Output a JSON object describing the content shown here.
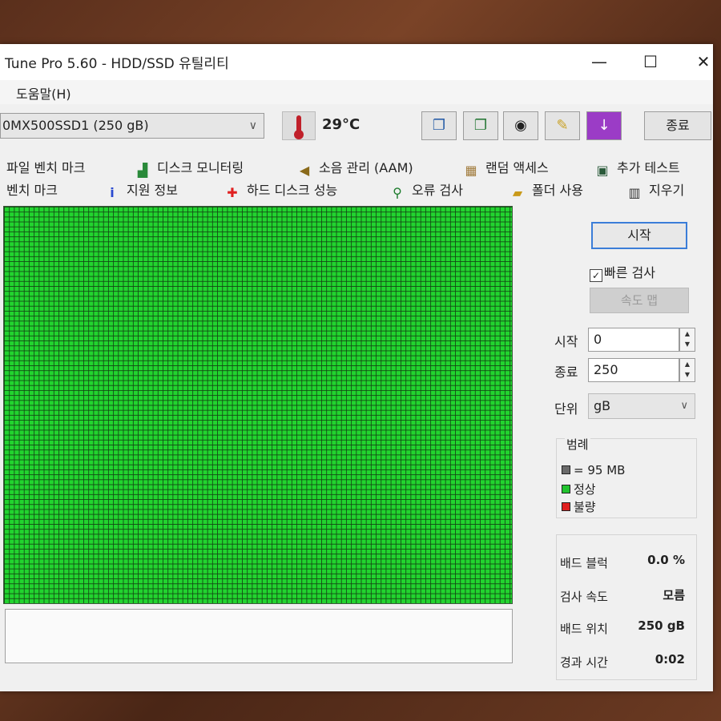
{
  "window": {
    "title": "Tune Pro 5.60 - HDD/SSD  유틸리티",
    "min_glyph": "—",
    "max_glyph": "☐",
    "close_glyph": "✕"
  },
  "menu": {
    "items": [
      {
        "label": "도움말(H)"
      }
    ]
  },
  "toolbar": {
    "drive": "0MX500SSD1 (250 gB)",
    "temperature": "29°C",
    "exit_label": "종료",
    "buttons": [
      {
        "icon": "copy-info-icon",
        "glyph": "❐"
      },
      {
        "icon": "copy-screenshot-icon",
        "glyph": "❐"
      },
      {
        "icon": "camera-icon",
        "glyph": "◉"
      },
      {
        "icon": "options-icon",
        "glyph": "✎"
      },
      {
        "icon": "download-icon",
        "glyph": "↓"
      }
    ]
  },
  "tabs": {
    "row1": [
      {
        "label": "파일 벤치 마크",
        "icon": "file-benchmark-icon"
      },
      {
        "label": "디스크 모니터링",
        "icon": "disk-monitor-icon"
      },
      {
        "label": "소음 관리 (AAM)",
        "icon": "speaker-icon"
      },
      {
        "label": "랜덤 액세스",
        "icon": "random-access-icon"
      },
      {
        "label": "추가 테스트",
        "icon": "extra-tests-icon"
      }
    ],
    "row2": [
      {
        "label": "벤치 마크",
        "icon": "benchmark-icon"
      },
      {
        "label": "지원 정보",
        "icon": "info-icon"
      },
      {
        "label": "하드 디스크 성능",
        "icon": "health-cross-icon"
      },
      {
        "label": "오류 검사",
        "icon": "error-scan-icon"
      },
      {
        "label": "폴더 사용",
        "icon": "folder-icon"
      },
      {
        "label": "지우기",
        "icon": "trash-icon"
      }
    ]
  },
  "controls": {
    "start_label": "시작",
    "quick_scan_label": "빠른 검사",
    "quick_scan_checked": true,
    "speed_map_label": "속도 맵",
    "start_field_label": "시작",
    "start_value": "0",
    "end_field_label": "종료",
    "end_value": "250",
    "unit_label": "단위",
    "unit_value": "gB"
  },
  "legend": {
    "title": "범례",
    "items": [
      {
        "label": "= 95 MB",
        "color": "#6b6b6b"
      },
      {
        "label": "정상",
        "color": "#22c42f"
      },
      {
        "label": "불량",
        "color": "#e02020"
      }
    ]
  },
  "stats": [
    {
      "label": "배드 블럭",
      "value": "0.0 %"
    },
    {
      "label": "검사 속도",
      "value": "모름"
    },
    {
      "label": "배드 위치",
      "value": "250 gB"
    },
    {
      "label": "경과 시간",
      "value": "0:02"
    }
  ]
}
